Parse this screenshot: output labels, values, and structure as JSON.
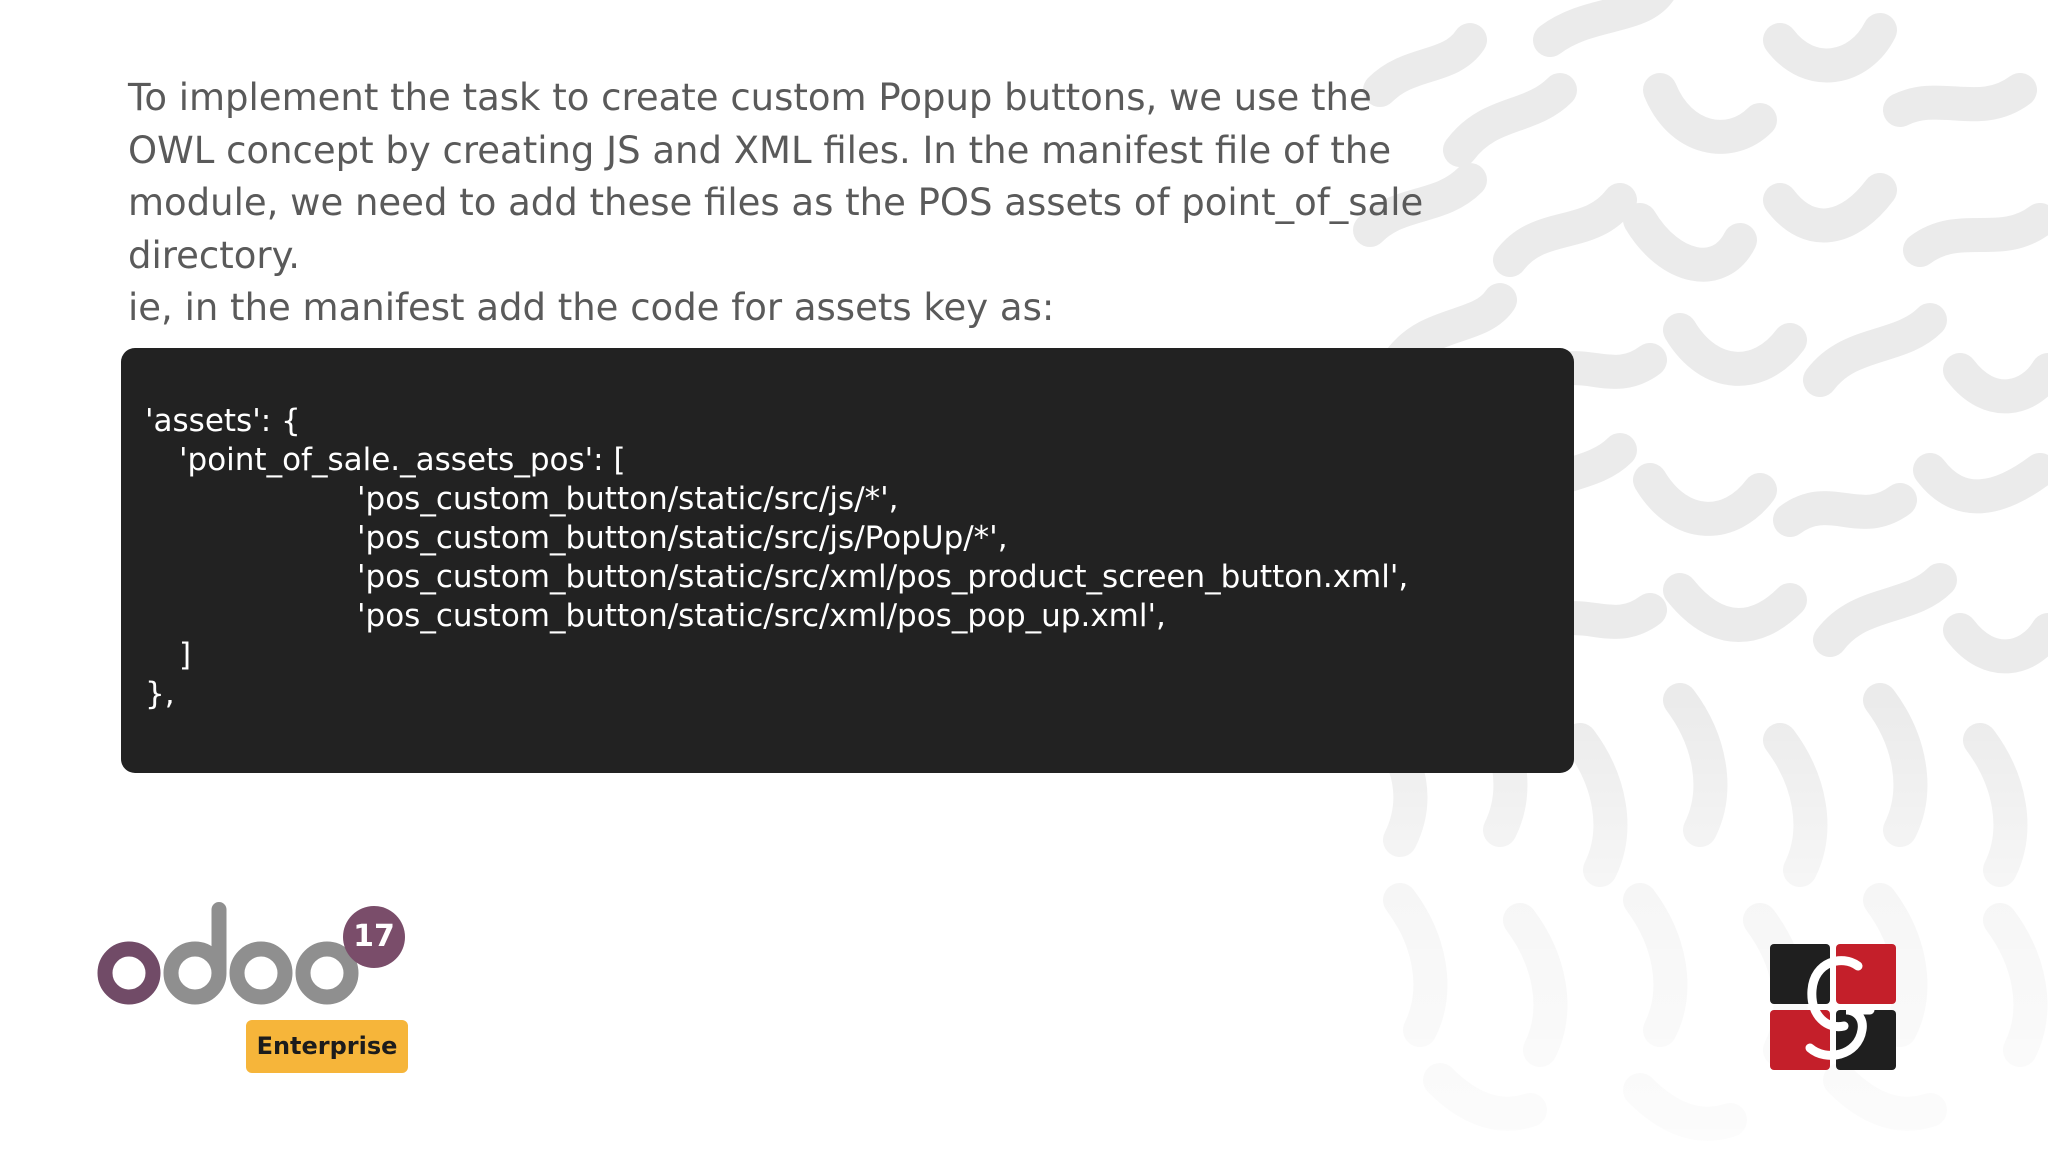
{
  "intro": {
    "lines": [
      "To implement the task to create custom Popup buttons, we use the",
      "OWL concept by creating JS and XML files. In the manifest file of the",
      "module, we need to add these files as the POS assets of point_of_sale",
      "directory.",
      "ie, in the manifest add the code for assets key as:"
    ]
  },
  "code": {
    "lines": [
      "'assets': {",
      "'point_of_sale._assets_pos': [",
      "'pos_custom_button/static/src/js/*',",
      "'pos_custom_button/static/src/js/PopUp/*',",
      "'pos_custom_button/static/src/xml/pos_product_screen_button.xml',",
      "'pos_custom_button/static/src/xml/pos_pop_up.xml',",
      "]",
      "},"
    ]
  },
  "branding": {
    "odoo_version": "17",
    "edition": "Enterprise",
    "colors": {
      "odoo_purple": "#714b67",
      "odoo_gray": "#8f8f8f",
      "enterprise_yellow": "#f6b53a",
      "brand_red": "#c41f2a",
      "brand_dark": "#1f1f1f"
    }
  },
  "icons": {
    "odoo_logo": "odoo-logo-icon",
    "brand_logo": "cybrosys-logo-icon",
    "background": "abstract-squiggle-pattern"
  }
}
